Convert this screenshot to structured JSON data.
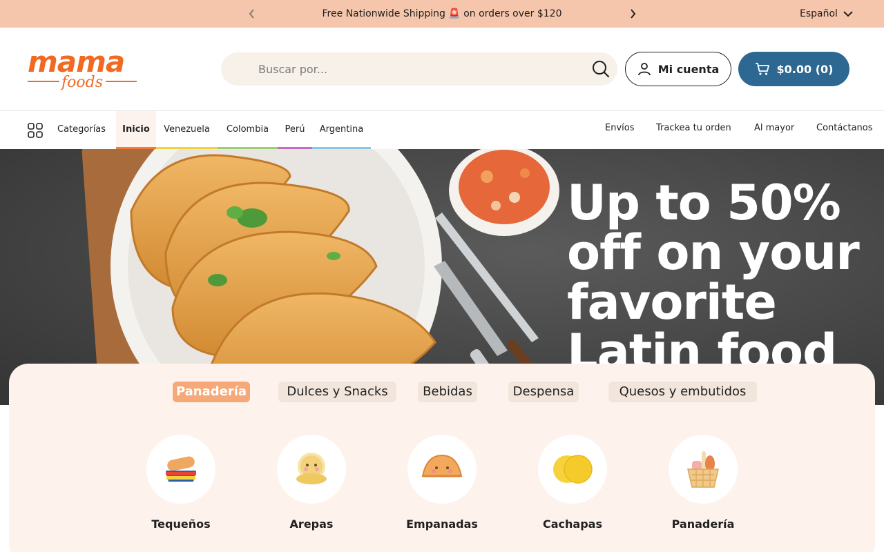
{
  "announcement": {
    "message": "Free Nationwide Shipping 🚨 on orders over $120",
    "language": "Español"
  },
  "header": {
    "logo_top": "mama",
    "logo_bottom": "foods",
    "search_placeholder": "Buscar por...",
    "account_label": "Mi cuenta",
    "cart_label": "$0.00 (0)"
  },
  "nav": {
    "categories_label": "Categorías",
    "items": [
      {
        "label": "Inicio",
        "color": "#f47a3c"
      },
      {
        "label": "Venezuela",
        "color": "#f5d23a"
      },
      {
        "label": "Colombia",
        "color": "#9ccf6e"
      },
      {
        "label": "Perú",
        "color": "#c46ac0"
      },
      {
        "label": "Argentina",
        "color": "#86c8e6"
      }
    ],
    "right_links": [
      "Envíos",
      "Trackea tu orden",
      "Al mayor",
      "Contáctanos"
    ]
  },
  "hero": {
    "headline": "Up to 50% off on your favorite Latin food"
  },
  "category_tabs": [
    "Panadería",
    "Dulces y Snacks",
    "Bebidas",
    "Despensa",
    "Quesos y embutidos"
  ],
  "categories": [
    {
      "label": "Tequeños",
      "icon": "tequenos-icon"
    },
    {
      "label": "Arepas",
      "icon": "arepas-icon"
    },
    {
      "label": "Empanadas",
      "icon": "empanadas-icon"
    },
    {
      "label": "Cachapas",
      "icon": "cachapas-icon"
    },
    {
      "label": "Panadería",
      "icon": "bread-basket-icon"
    }
  ],
  "colors": {
    "announcement_bg": "#f5c6ab",
    "brand_orange": "#f26a21",
    "cart_blue": "#2c6891",
    "panel_bg": "#fdf2ec",
    "active_tab": "#f6a878"
  }
}
